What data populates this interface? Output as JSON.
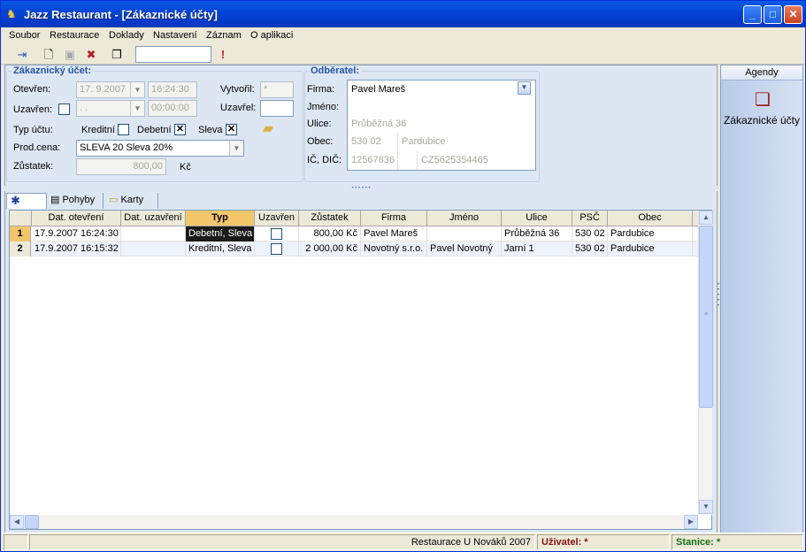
{
  "window": {
    "title": "Jazz Restaurant - [Zákaznické účty]",
    "min": "_",
    "max": "□",
    "close": "✕"
  },
  "menu": [
    "Soubor",
    "Restaurace",
    "Doklady",
    "Nastavení",
    "Záznam",
    "O aplikaci"
  ],
  "form": {
    "customer": {
      "title": "Zákaznický účet:",
      "opened_label": "Otevřen:",
      "opened_date": "17. 9.2007",
      "opened_time": "16:24:30",
      "closed_label": "Uzavřen:",
      "closed_date": ". .",
      "closed_time": "00:00:00",
      "created_by_label": "Vytvořil:",
      "created_by_value": "*",
      "closed_by_label": "Uzavřel:",
      "closed_by_value": "",
      "type_label": "Typ účtu:",
      "credit_label": "Kreditní",
      "credit_checked": "",
      "debit_label": "Debetní",
      "debit_checked": "✕",
      "discount_label": "Sleva",
      "discount_checked": "✕",
      "price_label": "Prod.cena:",
      "price_value": "SLEVA 20 Sleva 20%",
      "balance_label": "Zůstatek:",
      "balance_value": "800,00",
      "currency": "Kč"
    },
    "customer_party": {
      "title": "Odběratel:",
      "firm_label": "Firma:",
      "firm_value": "Pavel Mareš",
      "name_label": "Jméno:",
      "name_value": "",
      "street_label": "Ulice:",
      "street_value": "Průběžná 36",
      "city_label": "Obec:",
      "zip_value": "530 02",
      "city_value": "Pardubice",
      "ic_label": "IČ, DIČ:",
      "ic_value": "12567836",
      "dic_value": "CZ5625354465"
    }
  },
  "tabs": {
    "first": "✱",
    "movements": "Pohyby",
    "cards": "Karty"
  },
  "grid": {
    "columns": [
      "Dat. otevření",
      "Dat. uzavření",
      "Typ",
      "Uzavřen",
      "Zůstatek",
      "Firma",
      "Jméno",
      "Ulice",
      "PSČ",
      "Obec"
    ],
    "rows": [
      {
        "n": "1",
        "opened": "17.9.2007 16:24:30",
        "closed": "",
        "type": "Debetní, Sleva",
        "closed_flag": "",
        "balance": "800,00 Kč",
        "firm": "Pavel Mareš",
        "name": "",
        "street": "Průběžná 36",
        "zip": "530 02",
        "city": "Pardubice"
      },
      {
        "n": "2",
        "opened": "17.9.2007 16:15:32",
        "closed": "",
        "type": "Kreditní, Sleva",
        "closed_flag": "",
        "balance": "2 000,00 Kč",
        "firm": "Novotný s.r.o.",
        "name": "Pavel Novotný",
        "street": "Jarní 1",
        "zip": "530 02",
        "city": "Pardubice"
      }
    ]
  },
  "agenda": {
    "title": "Agendy",
    "item": "Zákaznické účty"
  },
  "status": {
    "restaurant": "Restaurace U Nováků 2007",
    "user_label": "Uživatel: *",
    "station_label": "Stanice: *"
  }
}
